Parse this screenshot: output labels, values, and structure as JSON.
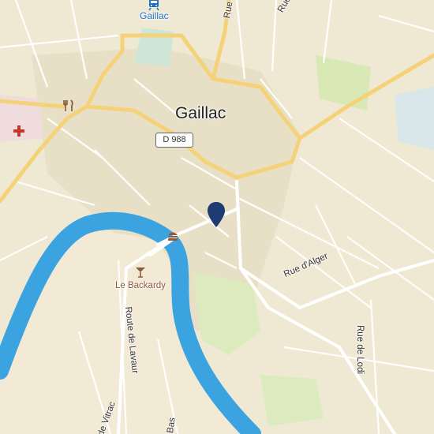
{
  "map": {
    "town_label": "Gaillac",
    "road_shield": "D 988",
    "streets": {
      "rue_alger": "Rue d'Alger",
      "rue_lodi": "Rue de Lodi",
      "route_lavaur": "Route de Lavaur",
      "vitrac": "de Vitrac",
      "bas": "Bas",
      "top_rue": "Rue",
      "top_rue_right": "Rue"
    },
    "station_label": "Gaillac",
    "poi_label": "Le Backardy",
    "colors": {
      "land": "#efe9d3",
      "urban": "#e6dfc8",
      "river": "#3aa3e0",
      "park": "#d6e8b4",
      "major_road": "#f5d27a",
      "pin": "#1f3b73",
      "hospital": "#c0392b",
      "poi": "#8b5a3c"
    },
    "icons": [
      "train-station-icon",
      "restaurant-icon",
      "hospital-icon",
      "bar-icon",
      "fast-food-icon",
      "location-pin-icon"
    ]
  }
}
